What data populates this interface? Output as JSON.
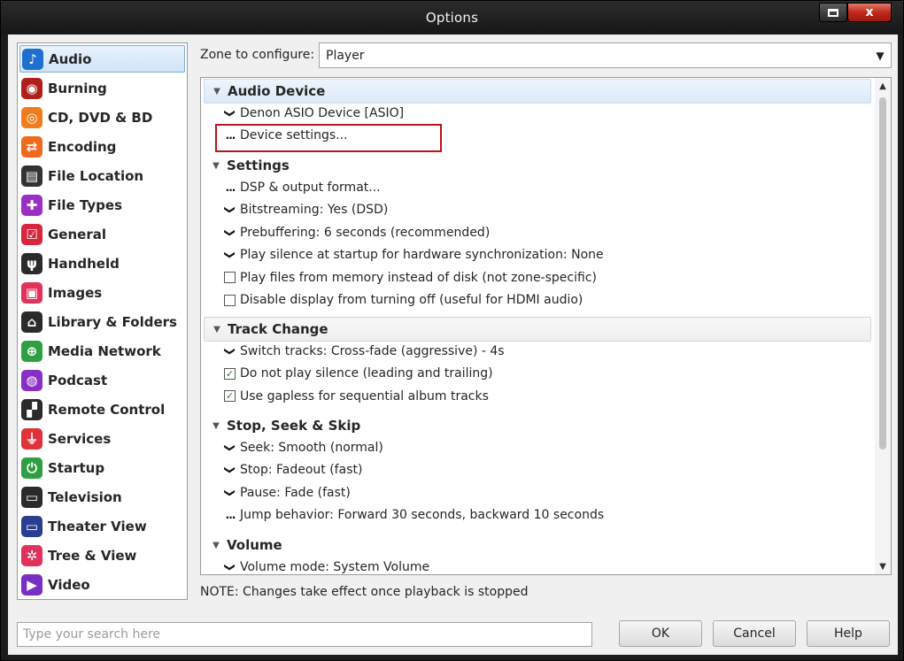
{
  "window": {
    "title": "Options",
    "maximize_icon": "maximize-icon",
    "close_glyph": "x"
  },
  "sidebar": {
    "items": [
      {
        "label": "Audio",
        "icon": "music-note-icon",
        "color": "#1f6fd1",
        "glyph": "♪",
        "selected": true
      },
      {
        "label": "Burning",
        "icon": "burning-disc-icon",
        "color": "#b0201a",
        "glyph": "◉"
      },
      {
        "label": "CD, DVD & BD",
        "icon": "disc-icon",
        "color": "#f07c1e",
        "glyph": "◎"
      },
      {
        "label": "Encoding",
        "icon": "encoding-icon",
        "color": "#f06a1e",
        "glyph": "⇄"
      },
      {
        "label": "File Location",
        "icon": "file-location-icon",
        "color": "#333333",
        "glyph": "▤"
      },
      {
        "label": "File Types",
        "icon": "puzzle-icon",
        "color": "#9b2fc4",
        "glyph": "✚"
      },
      {
        "label": "General",
        "icon": "general-icon",
        "color": "#d7263d",
        "glyph": "☑"
      },
      {
        "label": "Handheld",
        "icon": "handheld-usb-icon",
        "color": "#2b2b2b",
        "glyph": "ψ"
      },
      {
        "label": "Images",
        "icon": "camera-icon",
        "color": "#e0325a",
        "glyph": "▣"
      },
      {
        "label": "Library & Folders",
        "icon": "house-icon",
        "color": "#2b2b2b",
        "glyph": "⌂"
      },
      {
        "label": "Media Network",
        "icon": "network-icon",
        "color": "#2ea043",
        "glyph": "⊕"
      },
      {
        "label": "Podcast",
        "icon": "podcast-icon",
        "color": "#8a2fc4",
        "glyph": "◍"
      },
      {
        "label": "Remote Control",
        "icon": "remote-icon",
        "color": "#2b2b2b",
        "glyph": "▞"
      },
      {
        "label": "Services",
        "icon": "plug-icon",
        "color": "#e0323a",
        "glyph": "⏚"
      },
      {
        "label": "Startup",
        "icon": "power-icon",
        "color": "#2ea043",
        "glyph": "⏻"
      },
      {
        "label": "Television",
        "icon": "tv-icon",
        "color": "#2b2b2b",
        "glyph": "▭"
      },
      {
        "label": "Theater View",
        "icon": "monitor-icon",
        "color": "#2a3e8f",
        "glyph": "▭"
      },
      {
        "label": "Tree & View",
        "icon": "gear-icon",
        "color": "#e0325a",
        "glyph": "✲"
      },
      {
        "label": "Video",
        "icon": "video-camera-icon",
        "color": "#7a2fc4",
        "glyph": "▶"
      }
    ]
  },
  "zone": {
    "label": "Zone to configure:",
    "value": "Player",
    "arrow_glyph": "▼"
  },
  "tree": {
    "sections": [
      {
        "title": "Audio Device",
        "rows": [
          {
            "marker": "chevron",
            "text": "Denon ASIO Device [ASIO]"
          },
          {
            "marker": "dots",
            "text": "Device settings..."
          }
        ]
      },
      {
        "title": "Settings",
        "rows": [
          {
            "marker": "dots",
            "text": "DSP & output format..."
          },
          {
            "marker": "chevron",
            "text": "Bitstreaming: Yes (DSD)"
          },
          {
            "marker": "chevron",
            "text": "Prebuffering: 6 seconds (recommended)"
          },
          {
            "marker": "chevron",
            "text": "Play silence at startup for hardware synchronization: None"
          },
          {
            "marker": "checkbox",
            "checked": false,
            "text": "Play files from memory instead of disk (not zone-specific)"
          },
          {
            "marker": "checkbox",
            "checked": false,
            "text": "Disable display from turning off (useful for HDMI audio)"
          }
        ]
      },
      {
        "title": "Track Change",
        "rows": [
          {
            "marker": "chevron",
            "text": "Switch tracks: Cross-fade (aggressive) - 4s"
          },
          {
            "marker": "checkbox",
            "checked": true,
            "text": "Do not play silence (leading and trailing)"
          },
          {
            "marker": "checkbox",
            "checked": true,
            "text": "Use gapless for sequential album tracks"
          }
        ]
      },
      {
        "title": "Stop, Seek & Skip",
        "rows": [
          {
            "marker": "chevron",
            "text": "Seek: Smooth (normal)"
          },
          {
            "marker": "chevron",
            "text": "Stop: Fadeout (fast)"
          },
          {
            "marker": "chevron",
            "text": "Pause: Fade (fast)"
          },
          {
            "marker": "dots",
            "text": "Jump behavior: Forward 30 seconds, backward 10 seconds"
          }
        ]
      },
      {
        "title": "Volume",
        "rows": [
          {
            "marker": "chevron",
            "text": "Volume mode: System Volume"
          }
        ]
      }
    ],
    "glyphs": {
      "triangle": "▼",
      "chevron": "❯",
      "dots": "...",
      "check": "✓",
      "scroll_up": "▲",
      "scroll_down": "▼"
    }
  },
  "note": "NOTE: Changes take effect once playback is stopped",
  "footer": {
    "search_placeholder": "Type your search here",
    "ok_label": "OK",
    "cancel_label": "Cancel",
    "help_label": "Help"
  },
  "colors": {
    "highlight_box": "#b8151f",
    "selected_item_bg": "#cfe4f8"
  }
}
